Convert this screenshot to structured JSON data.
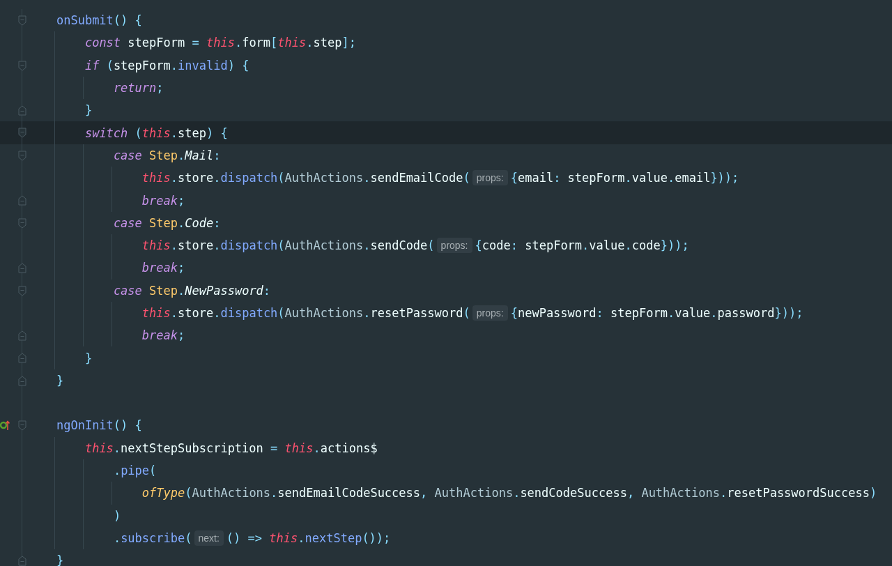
{
  "editor": {
    "lines": [
      {
        "kind": "block-start",
        "current": false,
        "implemented": false,
        "tokens": [
          {
            "kind": "m",
            "text": "onSubmit"
          },
          {
            "kind": "p",
            "text": "() {"
          }
        ],
        "children": [
          {
            "kind": "plain",
            "current": false,
            "implemented": false,
            "tokens": [
              {
                "kind": "k",
                "text": "const"
              },
              {
                "kind": "w",
                "text": " stepForm "
              },
              {
                "kind": "p",
                "text": "= "
              },
              {
                "kind": "t",
                "text": "this"
              },
              {
                "kind": "p",
                "text": "."
              },
              {
                "kind": "w",
                "text": "form"
              },
              {
                "kind": "p",
                "text": "["
              },
              {
                "kind": "t",
                "text": "this"
              },
              {
                "kind": "p",
                "text": "."
              },
              {
                "kind": "w",
                "text": "step"
              },
              {
                "kind": "p",
                "text": "];"
              }
            ]
          },
          {
            "kind": "block-start",
            "current": false,
            "implemented": false,
            "tokens": [
              {
                "kind": "k",
                "text": "if"
              },
              {
                "kind": "p",
                "text": " ("
              },
              {
                "kind": "w",
                "text": "stepForm"
              },
              {
                "kind": "p",
                "text": "."
              },
              {
                "kind": "m",
                "text": "invalid"
              },
              {
                "kind": "p",
                "text": ") {"
              }
            ],
            "children": [
              {
                "kind": "plain",
                "current": false,
                "implemented": false,
                "tokens": [
                  {
                    "kind": "k",
                    "text": "return"
                  },
                  {
                    "kind": "p",
                    "text": ";"
                  }
                ]
              }
            ]
          },
          {
            "kind": "block-end",
            "current": false,
            "implemented": false,
            "tokens": [
              {
                "kind": "p",
                "text": "}"
              }
            ]
          },
          {
            "kind": "block-start",
            "current": true,
            "implemented": false,
            "tokens": [
              {
                "kind": "k",
                "text": "switch"
              },
              {
                "kind": "p",
                "text": " ("
              },
              {
                "kind": "t",
                "text": "this"
              },
              {
                "kind": "p",
                "text": "."
              },
              {
                "kind": "w",
                "text": "step"
              },
              {
                "kind": "p",
                "text": ") {"
              }
            ],
            "children": [
              {
                "kind": "block-start",
                "current": false,
                "implemented": false,
                "tokens": [
                  {
                    "kind": "k",
                    "text": "case "
                  },
                  {
                    "kind": "y",
                    "text": "Step"
                  },
                  {
                    "kind": "p",
                    "text": "."
                  },
                  {
                    "kind": "i",
                    "text": "Mail"
                  },
                  {
                    "kind": "p",
                    "text": ":"
                  }
                ],
                "children": [
                  {
                    "kind": "plain",
                    "current": false,
                    "implemented": false,
                    "tokens": [
                      {
                        "kind": "t",
                        "text": "this"
                      },
                      {
                        "kind": "p",
                        "text": "."
                      },
                      {
                        "kind": "w",
                        "text": "store"
                      },
                      {
                        "kind": "p",
                        "text": "."
                      },
                      {
                        "kind": "m",
                        "text": "dispatch"
                      },
                      {
                        "kind": "p",
                        "text": "("
                      },
                      {
                        "kind": "c",
                        "text": "AuthActions"
                      },
                      {
                        "kind": "p",
                        "text": "."
                      },
                      {
                        "kind": "w",
                        "text": "sendEmailCode"
                      },
                      {
                        "kind": "p",
                        "text": "("
                      },
                      {
                        "kind": "h",
                        "text": "props:"
                      },
                      {
                        "kind": "p",
                        "text": "{"
                      },
                      {
                        "kind": "w",
                        "text": "email"
                      },
                      {
                        "kind": "p",
                        "text": ": "
                      },
                      {
                        "kind": "w",
                        "text": "stepForm"
                      },
                      {
                        "kind": "p",
                        "text": "."
                      },
                      {
                        "kind": "w",
                        "text": "value"
                      },
                      {
                        "kind": "p",
                        "text": "."
                      },
                      {
                        "kind": "w",
                        "text": "email"
                      },
                      {
                        "kind": "p",
                        "text": "}));"
                      }
                    ]
                  },
                  {
                    "kind": "block-end",
                    "current": false,
                    "implemented": false,
                    "tokens": [
                      {
                        "kind": "k",
                        "text": "break"
                      },
                      {
                        "kind": "p",
                        "text": ";"
                      }
                    ]
                  }
                ]
              },
              {
                "kind": "block-start",
                "current": false,
                "implemented": false,
                "tokens": [
                  {
                    "kind": "k",
                    "text": "case "
                  },
                  {
                    "kind": "y",
                    "text": "Step"
                  },
                  {
                    "kind": "p",
                    "text": "."
                  },
                  {
                    "kind": "i",
                    "text": "Code"
                  },
                  {
                    "kind": "p",
                    "text": ":"
                  }
                ],
                "children": [
                  {
                    "kind": "plain",
                    "current": false,
                    "implemented": false,
                    "tokens": [
                      {
                        "kind": "t",
                        "text": "this"
                      },
                      {
                        "kind": "p",
                        "text": "."
                      },
                      {
                        "kind": "w",
                        "text": "store"
                      },
                      {
                        "kind": "p",
                        "text": "."
                      },
                      {
                        "kind": "m",
                        "text": "dispatch"
                      },
                      {
                        "kind": "p",
                        "text": "("
                      },
                      {
                        "kind": "c",
                        "text": "AuthActions"
                      },
                      {
                        "kind": "p",
                        "text": "."
                      },
                      {
                        "kind": "w",
                        "text": "sendCode"
                      },
                      {
                        "kind": "p",
                        "text": "("
                      },
                      {
                        "kind": "h",
                        "text": "props:"
                      },
                      {
                        "kind": "p",
                        "text": "{"
                      },
                      {
                        "kind": "w",
                        "text": "code"
                      },
                      {
                        "kind": "p",
                        "text": ": "
                      },
                      {
                        "kind": "w",
                        "text": "stepForm"
                      },
                      {
                        "kind": "p",
                        "text": "."
                      },
                      {
                        "kind": "w",
                        "text": "value"
                      },
                      {
                        "kind": "p",
                        "text": "."
                      },
                      {
                        "kind": "w",
                        "text": "code"
                      },
                      {
                        "kind": "p",
                        "text": "}));"
                      }
                    ]
                  },
                  {
                    "kind": "block-end",
                    "current": false,
                    "implemented": false,
                    "tokens": [
                      {
                        "kind": "k",
                        "text": "break"
                      },
                      {
                        "kind": "p",
                        "text": ";"
                      }
                    ]
                  }
                ]
              },
              {
                "kind": "block-start",
                "current": false,
                "implemented": false,
                "tokens": [
                  {
                    "kind": "k",
                    "text": "case "
                  },
                  {
                    "kind": "y",
                    "text": "Step"
                  },
                  {
                    "kind": "p",
                    "text": "."
                  },
                  {
                    "kind": "i",
                    "text": "NewPassword"
                  },
                  {
                    "kind": "p",
                    "text": ":"
                  }
                ],
                "children": [
                  {
                    "kind": "plain",
                    "current": false,
                    "implemented": false,
                    "tokens": [
                      {
                        "kind": "t",
                        "text": "this"
                      },
                      {
                        "kind": "p",
                        "text": "."
                      },
                      {
                        "kind": "w",
                        "text": "store"
                      },
                      {
                        "kind": "p",
                        "text": "."
                      },
                      {
                        "kind": "m",
                        "text": "dispatch"
                      },
                      {
                        "kind": "p",
                        "text": "("
                      },
                      {
                        "kind": "c",
                        "text": "AuthActions"
                      },
                      {
                        "kind": "p",
                        "text": "."
                      },
                      {
                        "kind": "w",
                        "text": "resetPassword"
                      },
                      {
                        "kind": "p",
                        "text": "("
                      },
                      {
                        "kind": "h",
                        "text": "props:"
                      },
                      {
                        "kind": "p",
                        "text": "{"
                      },
                      {
                        "kind": "w",
                        "text": "newPassword"
                      },
                      {
                        "kind": "p",
                        "text": ": "
                      },
                      {
                        "kind": "w",
                        "text": "stepForm"
                      },
                      {
                        "kind": "p",
                        "text": "."
                      },
                      {
                        "kind": "w",
                        "text": "value"
                      },
                      {
                        "kind": "p",
                        "text": "."
                      },
                      {
                        "kind": "w",
                        "text": "password"
                      },
                      {
                        "kind": "p",
                        "text": "}));"
                      }
                    ]
                  },
                  {
                    "kind": "block-end",
                    "current": false,
                    "implemented": false,
                    "tokens": [
                      {
                        "kind": "k",
                        "text": "break"
                      },
                      {
                        "kind": "p",
                        "text": ";"
                      }
                    ]
                  }
                ]
              }
            ]
          },
          {
            "kind": "block-end",
            "current": false,
            "implemented": false,
            "tokens": [
              {
                "kind": "p",
                "text": "}"
              }
            ]
          }
        ]
      },
      {
        "kind": "block-end",
        "current": false,
        "implemented": false,
        "tokens": [
          {
            "kind": "p",
            "text": "}"
          }
        ]
      },
      {
        "kind": "blank"
      },
      {
        "kind": "block-start",
        "current": false,
        "implemented": true,
        "tokens": [
          {
            "kind": "m",
            "text": "ngOnInit"
          },
          {
            "kind": "p",
            "text": "() {"
          }
        ],
        "children": [
          {
            "kind": "plain",
            "current": false,
            "implemented": false,
            "tokens": [
              {
                "kind": "t",
                "text": "this"
              },
              {
                "kind": "p",
                "text": "."
              },
              {
                "kind": "w",
                "text": "nextStepSubscription"
              },
              {
                "kind": "p",
                "text": " = "
              },
              {
                "kind": "t",
                "text": "this"
              },
              {
                "kind": "p",
                "text": "."
              },
              {
                "kind": "w",
                "text": "actions$"
              }
            ],
            "children": [
              {
                "kind": "plain",
                "current": false,
                "implemented": false,
                "tokens": [
                  {
                    "kind": "p",
                    "text": "."
                  },
                  {
                    "kind": "m",
                    "text": "pipe"
                  },
                  {
                    "kind": "p",
                    "text": "("
                  }
                ],
                "children": [
                  {
                    "kind": "plain",
                    "current": false,
                    "implemented": false,
                    "tokens": [
                      {
                        "kind": "f",
                        "text": "ofType"
                      },
                      {
                        "kind": "p",
                        "text": "("
                      },
                      {
                        "kind": "c",
                        "text": "AuthActions"
                      },
                      {
                        "kind": "p",
                        "text": "."
                      },
                      {
                        "kind": "w",
                        "text": "sendEmailCodeSuccess"
                      },
                      {
                        "kind": "p",
                        "text": ", "
                      },
                      {
                        "kind": "c",
                        "text": "AuthActions"
                      },
                      {
                        "kind": "p",
                        "text": "."
                      },
                      {
                        "kind": "w",
                        "text": "sendCodeSuccess"
                      },
                      {
                        "kind": "p",
                        "text": ", "
                      },
                      {
                        "kind": "c",
                        "text": "AuthActions"
                      },
                      {
                        "kind": "p",
                        "text": "."
                      },
                      {
                        "kind": "w",
                        "text": "resetPasswordSuccess"
                      },
                      {
                        "kind": "p",
                        "text": ")"
                      }
                    ]
                  }
                ]
              },
              {
                "kind": "plain",
                "current": false,
                "implemented": false,
                "tokens": [
                  {
                    "kind": "p",
                    "text": ")"
                  }
                ]
              },
              {
                "kind": "plain",
                "current": false,
                "implemented": false,
                "tokens": [
                  {
                    "kind": "p",
                    "text": "."
                  },
                  {
                    "kind": "m",
                    "text": "subscribe"
                  },
                  {
                    "kind": "p",
                    "text": "("
                  },
                  {
                    "kind": "h",
                    "text": "next:"
                  },
                  {
                    "kind": "p",
                    "text": "() => "
                  },
                  {
                    "kind": "t",
                    "text": "this"
                  },
                  {
                    "kind": "p",
                    "text": "."
                  },
                  {
                    "kind": "m",
                    "text": "nextStep"
                  },
                  {
                    "kind": "p",
                    "text": "());"
                  }
                ]
              }
            ]
          }
        ]
      },
      {
        "kind": "block-end",
        "current": false,
        "implemented": false,
        "tokens": [
          {
            "kind": "p",
            "text": "}"
          }
        ]
      }
    ]
  }
}
